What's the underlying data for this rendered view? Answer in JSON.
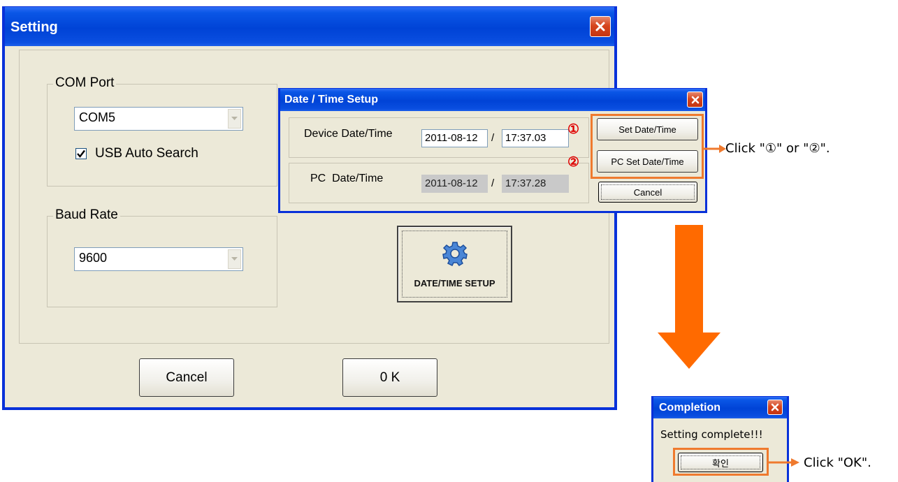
{
  "setting_window": {
    "title": "Setting",
    "com_port": {
      "group_label": "COM Port",
      "selected": "COM5",
      "usb_auto_search_label": "USB Auto Search",
      "usb_auto_search_checked": true
    },
    "baud_rate": {
      "group_label": "Baud Rate",
      "selected": "9600"
    },
    "datetime_setup_button_label": "DATE/TIME SETUP",
    "cancel_label": "Cancel",
    "ok_label": "0 K"
  },
  "datetime_dialog": {
    "title": "Date / Time Setup",
    "device_label": "Device Date/Time",
    "device_date": "2011-08-12",
    "device_time": "17:37.03",
    "pc_label": "PC  Date/Time",
    "pc_date": "2011-08-12",
    "pc_time": "17:37.28",
    "separator": "/",
    "set_button_label": "Set Date/Time",
    "pc_set_button_label": "PC Set Date/Time",
    "cancel_label": "Cancel"
  },
  "markers": {
    "one": "①",
    "two": "②"
  },
  "completion_dialog": {
    "title": "Completion",
    "message": "Setting complete!!!",
    "confirm_label": "확인"
  },
  "annotations": {
    "click_one_or_two": "Click \"①\" or \"②\".",
    "click_ok": "Click \"OK\"."
  },
  "colors": {
    "highlight": "#ef7a2e",
    "marker": "#e00000",
    "titlebar": "#0043d6"
  }
}
